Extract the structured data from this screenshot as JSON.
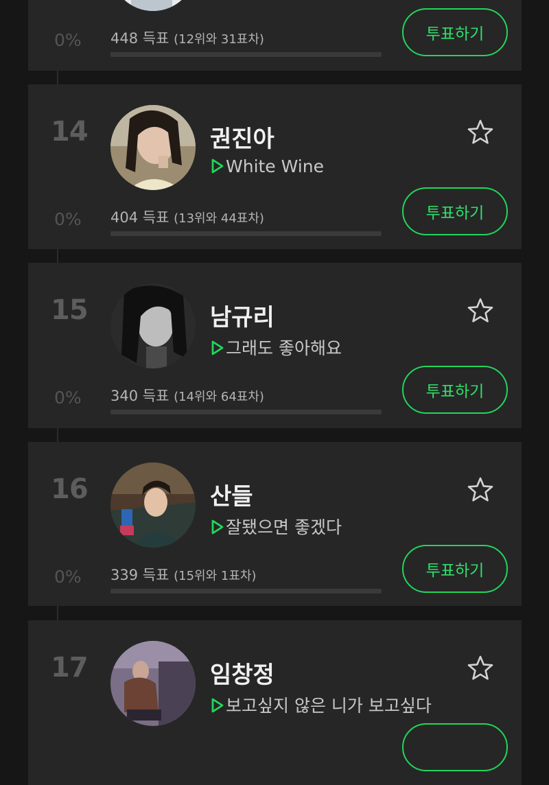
{
  "accent_color": "#22d65c",
  "entries": [
    {
      "rank": "",
      "name": "",
      "song": "",
      "percent": "0%",
      "votes_label": "448 득표",
      "gap_label": "(12위와 31표차)",
      "progress": 0,
      "vote_label": "투표하기",
      "favorite_icon": "star-outline-icon"
    },
    {
      "rank": "14",
      "name": "권진아",
      "song": "White Wine",
      "percent": "0%",
      "votes_label": "404 득표",
      "gap_label": "(13위와 44표차)",
      "progress": 0,
      "vote_label": "투표하기",
      "favorite_icon": "star-outline-icon"
    },
    {
      "rank": "15",
      "name": "남규리",
      "song": "그래도 좋아해요",
      "percent": "0%",
      "votes_label": "340 득표",
      "gap_label": "(14위와 64표차)",
      "progress": 0,
      "vote_label": "투표하기",
      "favorite_icon": "star-outline-icon"
    },
    {
      "rank": "16",
      "name": "산들",
      "song": "잘됐으면 좋겠다",
      "percent": "0%",
      "votes_label": "339 득표",
      "gap_label": "(15위와 1표차)",
      "progress": 0,
      "vote_label": "투표하기",
      "favorite_icon": "star-outline-icon"
    },
    {
      "rank": "17",
      "name": "임창정",
      "song": "보고싶지 않은 니가 보고싶다",
      "percent": "",
      "votes_label": "",
      "gap_label": "",
      "progress": 0,
      "vote_label": "",
      "favorite_icon": "star-outline-icon"
    }
  ]
}
